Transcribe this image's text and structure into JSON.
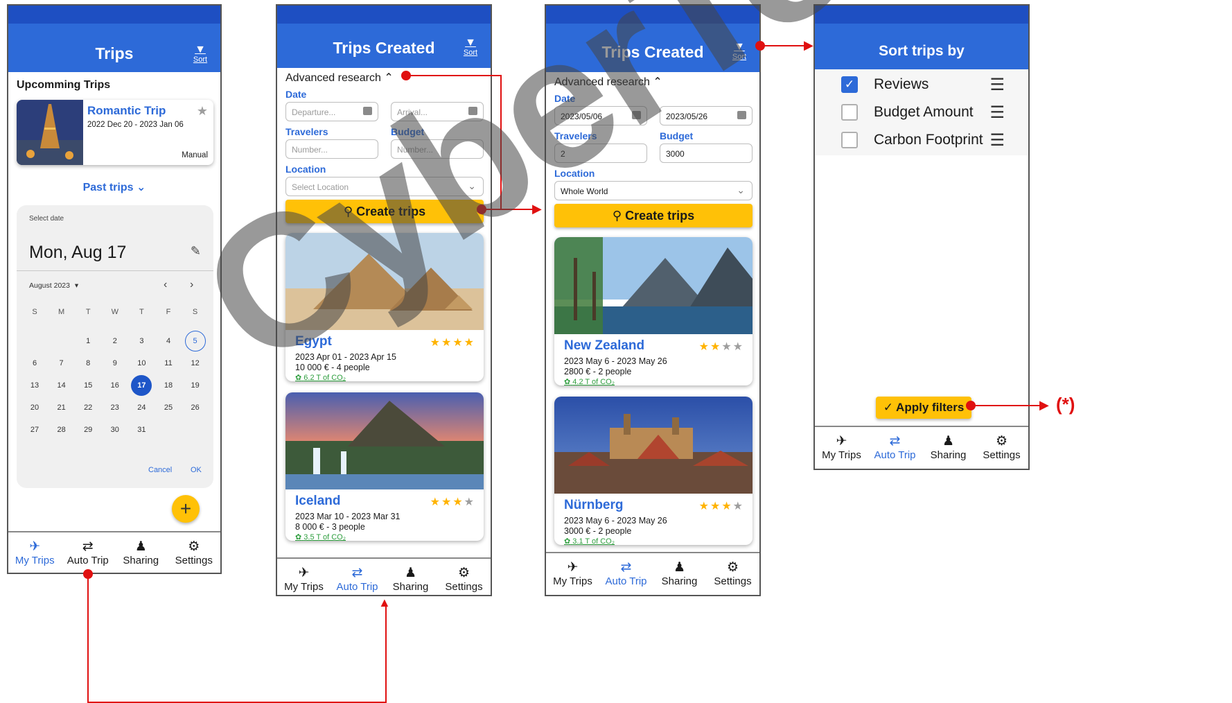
{
  "watermark": "CyberToni",
  "nav": {
    "my_trips": "My Trips",
    "auto_trip": "Auto Trip",
    "sharing": "Sharing",
    "settings": "Settings"
  },
  "screen1": {
    "title": "Trips",
    "sort_label": "Sort",
    "upcoming_heading": "Upcomming Trips",
    "trip_name": "Romantic Trip",
    "trip_dates": "2022 Dec 20 - 2023 Jan 06",
    "trip_mode": "Manual",
    "past_trips": "Past trips",
    "picker": {
      "select_date": "Select date",
      "selected_date": "Mon, Aug 17",
      "month_label": "August 2023",
      "weekdays": [
        "S",
        "M",
        "T",
        "W",
        "T",
        "F",
        "S"
      ],
      "days": [
        "1",
        "2",
        "3",
        "4",
        "5",
        "6",
        "7",
        "8",
        "9",
        "10",
        "11",
        "12",
        "13",
        "14",
        "15",
        "16",
        "17",
        "18",
        "19",
        "20",
        "21",
        "22",
        "23",
        "24",
        "25",
        "26",
        "27",
        "28",
        "29",
        "30",
        "31"
      ],
      "today": "5",
      "selected": "17",
      "cancel": "Cancel",
      "ok": "OK"
    },
    "fab": "+"
  },
  "screen2": {
    "title": "Trips Created",
    "sort_label": "Sort",
    "advanced": "Advanced research",
    "date_label": "Date",
    "departure_placeholder": "Departure...",
    "arrival_placeholder": "Arrival...",
    "travelers_label": "Travelers",
    "budget_label": "Budget",
    "travelers_placeholder": "Number...",
    "budget_placeholder": "Number...",
    "location_label": "Location",
    "location_placeholder": "Select Location",
    "create_button": "Create trips",
    "trips": [
      {
        "name": "Egypt",
        "dates": "2023 Apr 01 - 2023 Apr 15",
        "cost": "10 000 € - 4 people",
        "co2": "6.2 T of CO₂",
        "stars": 4
      },
      {
        "name": "Iceland",
        "dates": "2023 Mar 10 - 2023 Mar 31",
        "cost": "8 000 € - 3 people",
        "co2": "3.5 T of CO₂",
        "stars": 3
      }
    ]
  },
  "screen3": {
    "title": "Trips Created",
    "sort_label": "Sort",
    "advanced": "Advanced research",
    "date_label": "Date",
    "departure_value": "2023/05/06",
    "arrival_value": "2023/05/26",
    "travelers_label": "Travelers",
    "budget_label": "Budget",
    "travelers_value": "2",
    "budget_value": "3000",
    "location_label": "Location",
    "location_value": "Whole World",
    "create_button": "Create trips",
    "trips": [
      {
        "name": "New Zealand",
        "dates": "2023 May 6 - 2023 May 26",
        "cost": "2800 € - 2 people",
        "co2": "4.2 T of CO₂",
        "stars": 2
      },
      {
        "name": "Nürnberg",
        "dates": "2023 May 6 - 2023 May 26",
        "cost": "3000 € - 2 people",
        "co2": "3.1 T of CO₂",
        "stars": 3
      }
    ]
  },
  "screen4": {
    "title": "Sort trips by",
    "options": [
      {
        "label": "Reviews",
        "checked": true
      },
      {
        "label": "Budget Amount",
        "checked": false
      },
      {
        "label": "Carbon Footprint",
        "checked": false
      }
    ],
    "apply_button": "Apply filters"
  },
  "annotation": "(*)",
  "colors": {
    "primary": "#2d6ad8",
    "statusbar": "#1e4fc2",
    "accent": "#ffc107",
    "arrow": "#e01010"
  }
}
